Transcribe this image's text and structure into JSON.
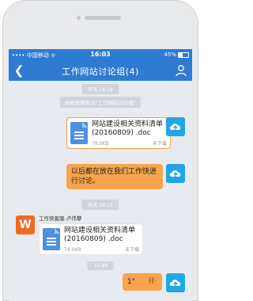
{
  "status_bar": {
    "carrier": "•••• 中国移动 ᯤ",
    "time": "16:03",
    "battery": "45%"
  },
  "header": {
    "back_icon": "chevron-left-icon",
    "title": "工作网站讨论组(4)",
    "members_icon": "person-icon"
  },
  "messages": {
    "time_1": "昨天 18:29",
    "system_1": "你修改群名为\"工作网站讨论组\"",
    "file_1": {
      "name": "网站建设相关资料清单 (20160809) .doc",
      "size": "78.0KB",
      "status": "未下载"
    },
    "text_1": "以后都在放在我们工作快进行讨论。",
    "time_2": "昨天 19:13",
    "sender_2": "工作快客服-卢伟攀",
    "file_2": {
      "name": "网站建设相关资料清单 (20160809) .doc",
      "size": "74.0KB",
      "status": "未下载"
    },
    "time_3": "15:48",
    "voice_duration": "1\"",
    "voice_icon": "sound-wave-icon"
  },
  "avatars": {
    "self_icon": "cloud-upload-icon",
    "other_letter": "W"
  },
  "colors": {
    "brand_blue": "#2f7bd1",
    "bubble_orange": "#f7a44c",
    "avatar_cyan": "#1fa6e6",
    "avatar_orange": "#f06a22"
  }
}
